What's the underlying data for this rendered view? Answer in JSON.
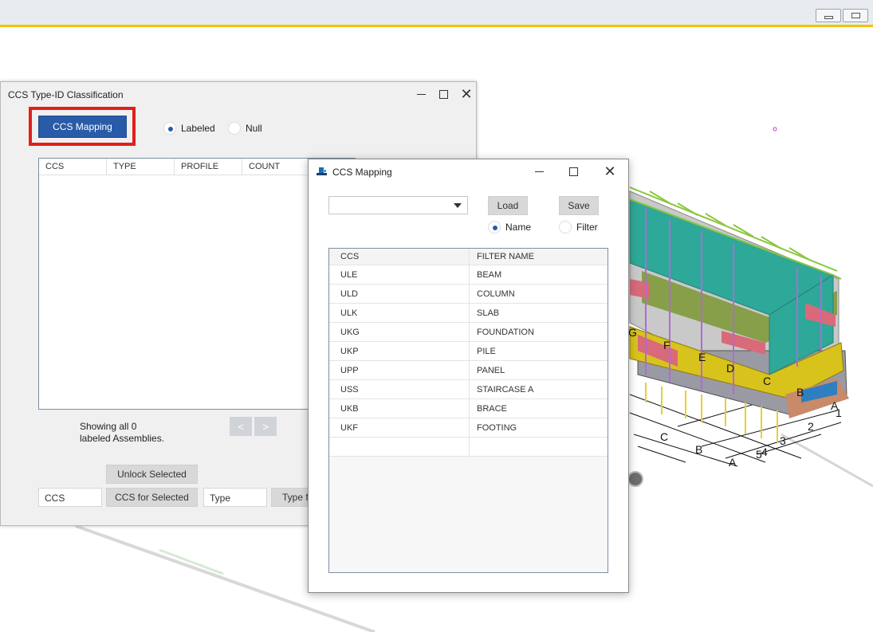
{
  "classification_window": {
    "title": "CCS Type-ID Classification",
    "ccs_mapping_button": "CCS Mapping",
    "radio_labeled": "Labeled",
    "radio_null": "Null",
    "columns": [
      "CCS",
      "TYPE",
      "PROFILE",
      "COUNT"
    ],
    "status_line1": "Showing all 0",
    "status_line2": "labeled Assemblies.",
    "prev_label": "<",
    "next_label": ">",
    "unlock_selected": "Unlock Selected",
    "ccs_input_value": "CCS",
    "ccs_for_selected": "CCS for Selected",
    "type_input_value": "Type",
    "type_for_selected": "Type fo"
  },
  "mapping_window": {
    "title": "CCS Mapping",
    "load": "Load",
    "save": "Save",
    "radio_name": "Name",
    "radio_filter": "Filter",
    "headers": [
      "CCS",
      "FILTER NAME"
    ],
    "rows": [
      [
        "ULE",
        "BEAM"
      ],
      [
        "ULD",
        "COLUMN"
      ],
      [
        "ULK",
        "SLAB"
      ],
      [
        "UKG",
        "FOUNDATION"
      ],
      [
        "UKP",
        "PILE"
      ],
      [
        "UPP",
        "PANEL"
      ],
      [
        "USS",
        "STAIRCASE A"
      ],
      [
        "UKB",
        "BRACE"
      ],
      [
        "UKF",
        "FOOTING"
      ]
    ]
  },
  "model_labels": {
    "grid_letters": [
      "G",
      "F",
      "E",
      "D",
      "C",
      "B",
      "A"
    ],
    "grid_numbers": [
      "1",
      "2",
      "3",
      "4",
      "5"
    ]
  },
  "colors": {
    "accent_yellow": "#f2c200",
    "button_blue": "#2a5ba8",
    "highlight_red": "#e0201b"
  }
}
